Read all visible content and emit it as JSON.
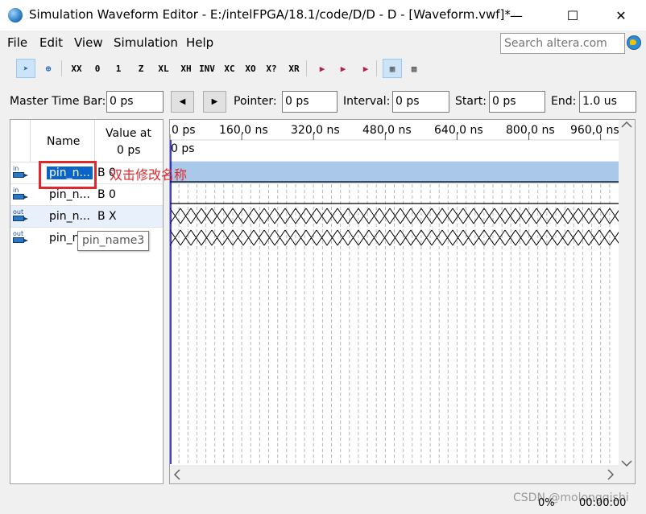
{
  "window": {
    "title": "Simulation Waveform Editor - E:/intelFPGA/18.1/code/D/D - D - [Waveform.vwf]*",
    "minimize": "—",
    "maximize": "☐",
    "close": "✕"
  },
  "menu": {
    "items": [
      {
        "label": "File"
      },
      {
        "label": "Edit"
      },
      {
        "label": "View"
      },
      {
        "label": "Simulation"
      },
      {
        "label": "Help"
      }
    ],
    "search_placeholder": "Search altera.com"
  },
  "toolbar": {
    "buttons": [
      {
        "name": "pointer-tool-icon",
        "glyph": "➤"
      },
      {
        "name": "zoom-tool-icon",
        "glyph": "⊕"
      },
      {
        "name": "force-unknown-icon",
        "glyph": "XX"
      },
      {
        "name": "force-low-icon",
        "glyph": "0"
      },
      {
        "name": "force-high-icon",
        "glyph": "1"
      },
      {
        "name": "force-high-z-icon",
        "glyph": "Z"
      },
      {
        "name": "force-weak-low-icon",
        "glyph": "XL"
      },
      {
        "name": "force-weak-high-icon",
        "glyph": "XH"
      },
      {
        "name": "invert-icon",
        "glyph": "INV"
      },
      {
        "name": "count-value-icon",
        "glyph": "XC"
      },
      {
        "name": "clock-icon",
        "glyph": "XO"
      },
      {
        "name": "random-icon",
        "glyph": "X?"
      },
      {
        "name": "arbitrary-value-icon",
        "glyph": "XR"
      },
      {
        "name": "run-functional-sim-icon",
        "glyph": "▶"
      },
      {
        "name": "run-timing-sim-icon",
        "glyph": "▶"
      },
      {
        "name": "generate-netlist-icon",
        "glyph": "▶"
      },
      {
        "name": "snap-to-grid-icon",
        "glyph": "▦"
      },
      {
        "name": "grid-settings-icon",
        "glyph": "▩"
      }
    ]
  },
  "timebar": {
    "master_label": "Master Time Bar:",
    "master_value": "0 ps",
    "prev": "◀",
    "next": "▶",
    "pointer_label": "Pointer:",
    "pointer_value": "0 ps",
    "interval_label": "Interval:",
    "interval_value": "0 ps",
    "start_label": "Start:",
    "start_value": "0 ps",
    "end_label": "End:",
    "end_value": "1.0 us"
  },
  "signal_table": {
    "name_header": "Name",
    "value_header_line1": "Value at",
    "value_header_line2": "0 ps",
    "rows": [
      {
        "dir": "in",
        "name": "pin_n...",
        "value": "B 0",
        "selected": true
      },
      {
        "dir": "in",
        "name": "pin_n...",
        "value": "B 0",
        "selected": false
      },
      {
        "dir": "out",
        "name": "pin_n...",
        "value": "B X",
        "selected": false
      },
      {
        "dir": "out",
        "name": "pin_n",
        "value": "",
        "selected": false
      }
    ]
  },
  "waveform": {
    "time_labels": [
      "0 ps",
      "160,0 ns",
      "320,0 ns",
      "480,0 ns",
      "640,0 ns",
      "800,0 ns",
      "960,0 ns"
    ],
    "cursor_label": "0 ps",
    "signals": [
      "low",
      "low",
      "unknown",
      "unknown"
    ]
  },
  "annotation": {
    "text": "双击修改名称"
  },
  "tooltip": {
    "text": "pin_name3"
  },
  "status": {
    "percent": "0%",
    "time": "00:00:00"
  },
  "watermark": "CSDN @molongqishi",
  "colors": {
    "selection": "#aac8ea",
    "annotation_red": "#e0282c",
    "cursor_blue": "#0000c8"
  }
}
